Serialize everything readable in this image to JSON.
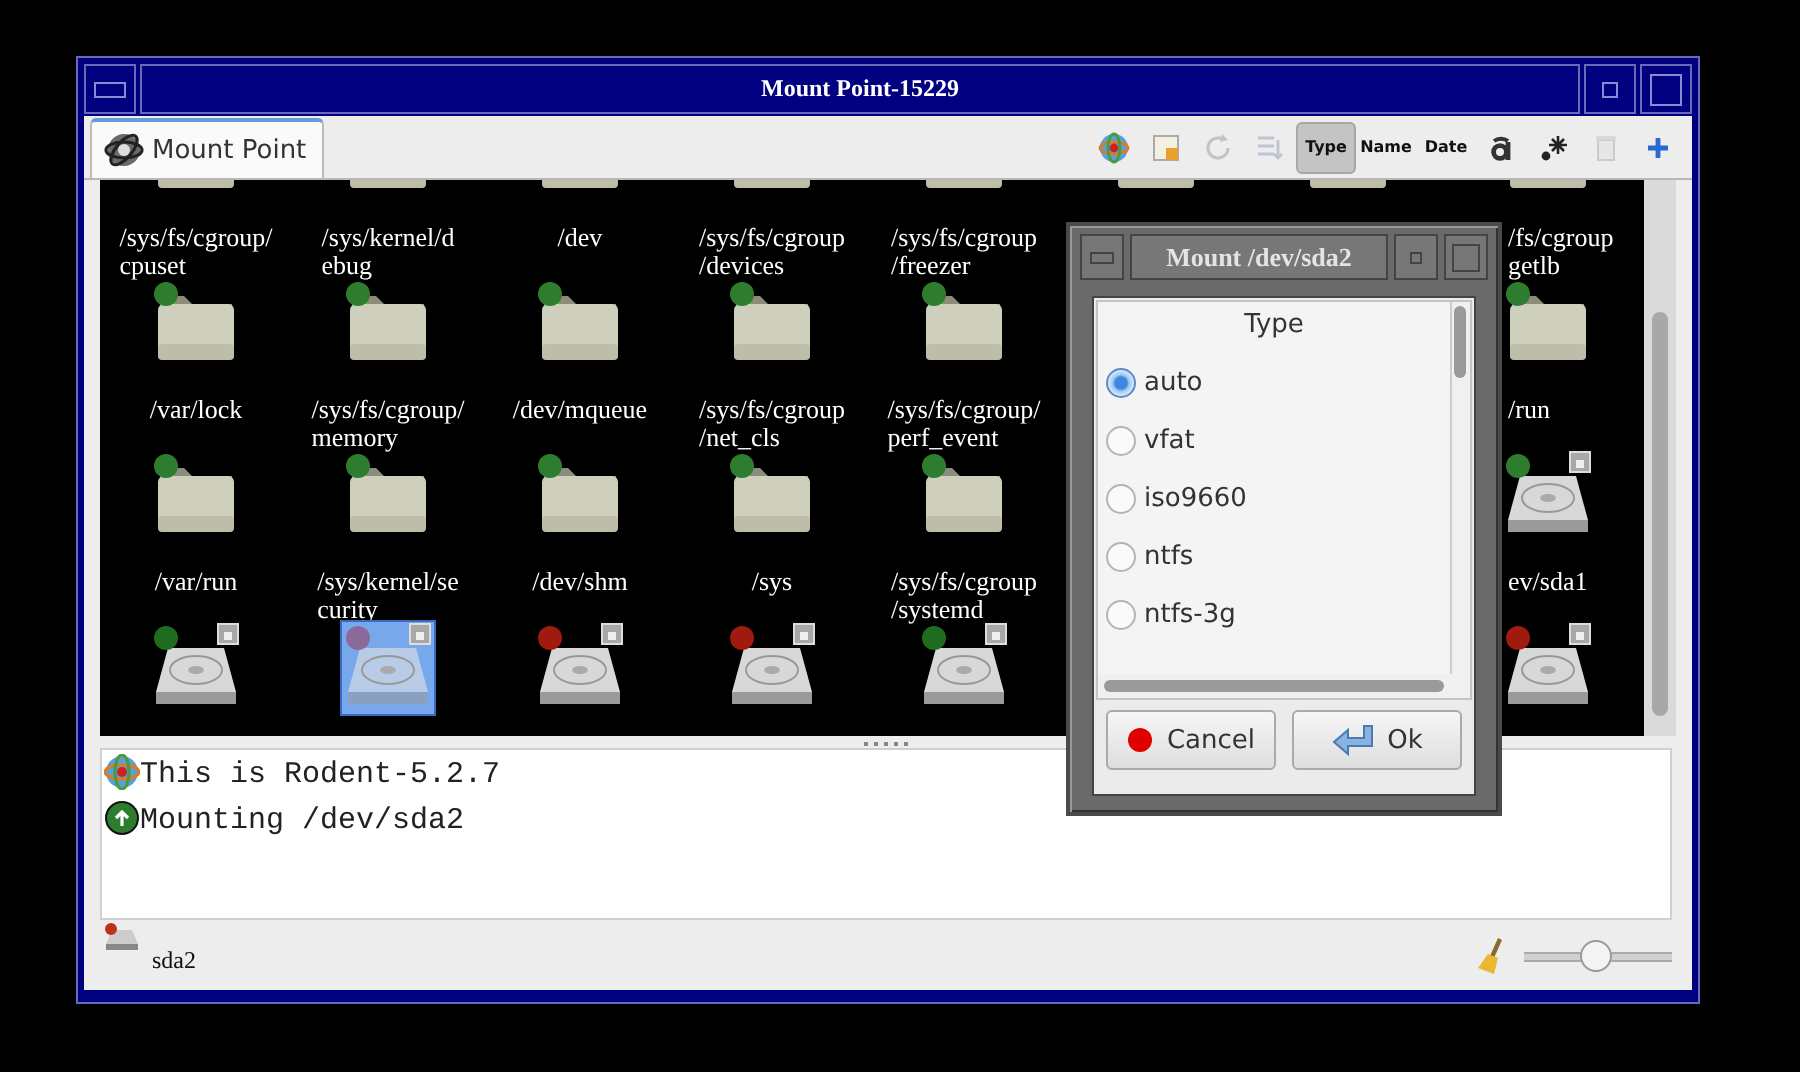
{
  "window": {
    "title": "Mount Point-15229"
  },
  "tabs": [
    {
      "label": "Mount Point",
      "selected": true
    }
  ],
  "toolbar": [
    {
      "kind": "icon",
      "disabled": false
    },
    {
      "kind": "icon",
      "disabled": false
    },
    {
      "kind": "icon",
      "disabled": true
    },
    {
      "kind": "icon",
      "disabled": true
    },
    {
      "kind": "sort",
      "label": "Type",
      "selected": true
    },
    {
      "kind": "sort",
      "label": "Name",
      "selected": false
    },
    {
      "kind": "sort",
      "label": "Date",
      "selected": false
    },
    {
      "kind": "icon",
      "disabled": false
    },
    {
      "kind": "icon",
      "disabled": false
    },
    {
      "kind": "icon",
      "disabled": true
    },
    {
      "kind": "icon",
      "disabled": false
    }
  ],
  "icon_grid": {
    "rows": [
      {
        "items": [
          {
            "kind": "folder",
            "label": "/sys/fs/cgroup/\ncpuset",
            "selected": false
          },
          {
            "kind": "folder",
            "label": "/sys/kernel/d\nebug",
            "selected": false
          },
          {
            "kind": "folder",
            "label": "/dev",
            "selected": false
          },
          {
            "kind": "folder",
            "label": "/sys/fs/cgroup\n/devices",
            "selected": false
          },
          {
            "kind": "folder",
            "label": "/sys/fs/cgroup\n/freezer",
            "selected": false
          },
          {
            "kind": "folder",
            "selected": false
          },
          {
            "kind": "folder",
            "selected": false
          },
          {
            "kind": "folder",
            "label": "/fs/cgroup\ngetlb",
            "selected": false
          }
        ]
      },
      {
        "items": [
          {
            "kind": "folder",
            "color": "#2e7d2e",
            "label": "/var/lock",
            "selected": false
          },
          {
            "kind": "folder",
            "color": "#2e7d2e",
            "label": "/sys/fs/cgroup/\nmemory",
            "selected": false
          },
          {
            "kind": "folder",
            "color": "#2e7d2e",
            "label": "/dev/mqueue",
            "selected": false
          },
          {
            "kind": "folder",
            "color": "#2e7d2e",
            "label": "/sys/fs/cgroup\n/net_cls",
            "selected": false
          },
          {
            "kind": "folder",
            "color": "#2e7d2e",
            "label": "/sys/fs/cgroup/\nperf_event",
            "selected": false
          },
          {
            "kind": "covered"
          },
          {
            "kind": "covered"
          },
          {
            "kind": "folder",
            "color": "#2e7d2e",
            "label": "/run",
            "selected": false
          }
        ]
      },
      {
        "items": [
          {
            "kind": "folder",
            "color": "#2e7d2e",
            "label": "/var/run",
            "selected": false
          },
          {
            "kind": "folder",
            "color": "#2e7d2e",
            "label": "/sys/kernel/se\ncurity",
            "selected": false
          },
          {
            "kind": "folder",
            "color": "#2e7d2e",
            "label": "/dev/shm",
            "selected": false
          },
          {
            "kind": "folder",
            "color": "#2e7d2e",
            "label": "/sys",
            "selected": false
          },
          {
            "kind": "folder",
            "color": "#2e7d2e",
            "label": "/sys/fs/cgroup\n/systemd",
            "selected": false
          },
          {
            "kind": "covered"
          },
          {
            "kind": "covered"
          },
          {
            "kind": "disk",
            "color": "#2e7d2e",
            "label": "ev/sda1",
            "selected": false
          }
        ]
      },
      {
        "items": [
          {
            "kind": "disk",
            "color": "#1f6b1f",
            "selected": false
          },
          {
            "kind": "disk",
            "color": "#8a6a9a",
            "selected": true
          },
          {
            "kind": "disk",
            "color": "#a01a10",
            "selected": false
          },
          {
            "kind": "disk",
            "color": "#a01a10",
            "selected": false
          },
          {
            "kind": "disk",
            "color": "#1f6b1f",
            "selected": false
          },
          {
            "kind": "covered"
          },
          {
            "kind": "covered"
          },
          {
            "kind": "disk",
            "color": "#a01a10",
            "selected": false
          }
        ]
      }
    ]
  },
  "log": [
    {
      "kind": "info",
      "text": "This is Rodent-5.2.7"
    },
    {
      "kind": "mount",
      "text": "Mounting /dev/sda2"
    }
  ],
  "status_bar": {
    "device": "sda2",
    "zoom": {
      "level": 0.49
    }
  },
  "dialog": {
    "title": "Mount /dev/sda2",
    "list_header": "Type",
    "options": [
      {
        "label": "auto",
        "selected": true
      },
      {
        "label": "vfat",
        "selected": false
      },
      {
        "label": "iso9660",
        "selected": false
      },
      {
        "label": "ntfs",
        "selected": false
      },
      {
        "label": "ntfs-3g",
        "selected": false
      }
    ],
    "buttons": [
      {
        "kind": "cancel",
        "label": "Cancel"
      },
      {
        "kind": "ok",
        "label": "Ok"
      }
    ]
  }
}
